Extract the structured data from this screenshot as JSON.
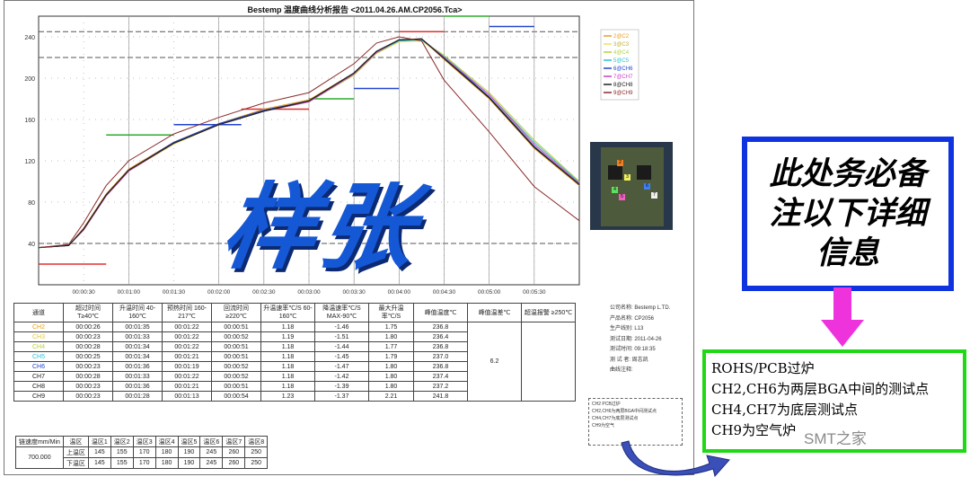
{
  "report_title": "Bestemp 温度曲线分析报告 <2011.04.26.AM.CP2056.Tca>",
  "stamp_text": "样张",
  "chart_data": {
    "type": "line",
    "xlabel": "",
    "ylabel": "",
    "x_range": [
      "00:00:00",
      "00:06:00"
    ],
    "ylim": [
      0,
      260
    ],
    "y_ticks": [
      "40",
      "80",
      "120",
      "160",
      "200",
      "240"
    ],
    "x_ticks": [
      "00:00:30",
      "00:01:00",
      "00:01:30",
      "00:02:00",
      "00:02:30",
      "00:03:00",
      "00:03:30",
      "00:04:00",
      "00:04:30",
      "00:05:00",
      "00:05:30"
    ],
    "x_seconds": [
      0,
      20,
      30,
      45,
      60,
      90,
      120,
      150,
      180,
      210,
      225,
      240,
      255,
      270,
      300,
      330,
      360
    ],
    "limit_lines": [
      40,
      220,
      245
    ],
    "zone_setpoints": [
      {
        "x0": 0,
        "x1": 45,
        "value": 20,
        "color": "#e03030"
      },
      {
        "x0": 45,
        "x1": 90,
        "value": 145,
        "color": "#2faa2f"
      },
      {
        "x0": 90,
        "x1": 135,
        "value": 155,
        "color": "#2244cc"
      },
      {
        "x0": 135,
        "x1": 180,
        "value": 170,
        "color": "#e03030"
      },
      {
        "x0": 180,
        "x1": 210,
        "value": 180,
        "color": "#2faa2f"
      },
      {
        "x0": 210,
        "x1": 240,
        "value": 190,
        "color": "#2244cc"
      },
      {
        "x0": 240,
        "x1": 270,
        "value": 245,
        "color": "#e03030"
      },
      {
        "x0": 270,
        "x1": 300,
        "value": 260,
        "color": "#2faa2f"
      },
      {
        "x0": 300,
        "x1": 330,
        "value": 250,
        "color": "#2244cc"
      }
    ],
    "legend_position": "top-right",
    "series": [
      {
        "name": "2@C2",
        "color": "#e8a020",
        "values": [
          36,
          38,
          55,
          88,
          112,
          138,
          156,
          170,
          179,
          205,
          226,
          237,
          238,
          218,
          180,
          132,
          96
        ]
      },
      {
        "name": "3@C3",
        "color": "#f0e060",
        "values": [
          36,
          38,
          53,
          86,
          110,
          136,
          155,
          168,
          177,
          203,
          224,
          235,
          236,
          220,
          182,
          136,
          98
        ]
      },
      {
        "name": "4@C4",
        "color": "#b8d040",
        "values": [
          36,
          38,
          53,
          86,
          110,
          137,
          155,
          168,
          177,
          203,
          224,
          236,
          237,
          222,
          186,
          140,
          100
        ]
      },
      {
        "name": "5@C5",
        "color": "#30c0d0",
        "values": [
          36,
          38,
          54,
          87,
          111,
          137,
          155,
          168,
          177,
          204,
          225,
          236,
          237,
          221,
          184,
          138,
          99
        ]
      },
      {
        "name": "6@CH6",
        "color": "#2244cc",
        "values": [
          36,
          38,
          54,
          87,
          111,
          138,
          156,
          169,
          178,
          205,
          226,
          237,
          238,
          220,
          182,
          134,
          97
        ]
      },
      {
        "name": "7@CH7",
        "color": "#d040c0",
        "values": [
          36,
          38,
          53,
          86,
          110,
          137,
          155,
          168,
          177,
          204,
          225,
          237,
          238,
          220,
          184,
          136,
          98
        ]
      },
      {
        "name": "8@CH8",
        "color": "#202020",
        "values": [
          36,
          38,
          54,
          87,
          111,
          137,
          155,
          168,
          178,
          205,
          226,
          237,
          238,
          219,
          181,
          133,
          97
        ]
      },
      {
        "name": "9@CH9",
        "color": "#8a2b2b",
        "values": [
          36,
          39,
          60,
          96,
          120,
          146,
          162,
          176,
          186,
          214,
          234,
          240,
          236,
          198,
          148,
          95,
          62
        ]
      }
    ]
  },
  "table": {
    "headers": [
      "通道",
      "超过时间 T≥40℃",
      "升温时间 40-160℃",
      "预热时间 160-217℃",
      "回流时间 ≥220℃",
      "升温速率℃/S 60-160℃",
      "降温速率℃/S MAX-90℃",
      "最大升温 率℃/S",
      "峰值温度℃",
      "峰值温差℃",
      "超温报警 ≥250℃"
    ],
    "rows": [
      {
        "ch": "CH2",
        "color": "#e8a020",
        "cells": [
          "00:00:26",
          "00:01:35",
          "00:01:22",
          "00:00:51",
          "1.18",
          "-1.46",
          "1.75",
          "236.8"
        ]
      },
      {
        "ch": "CH3",
        "color": "#e0c840",
        "cells": [
          "00:00:23",
          "00:01:33",
          "00:01:22",
          "00:00:52",
          "1.19",
          "-1.51",
          "1.80",
          "236.4"
        ]
      },
      {
        "ch": "CH4",
        "color": "#b8d040",
        "cells": [
          "00:00:28",
          "00:01:34",
          "00:01:22",
          "00:00:51",
          "1.18",
          "-1.44",
          "1.77",
          "236.8"
        ]
      },
      {
        "ch": "CH5",
        "color": "#30c0d0",
        "cells": [
          "00:00:25",
          "00:01:34",
          "00:01:21",
          "00:00:51",
          "1.18",
          "-1.45",
          "1.79",
          "237.0"
        ]
      },
      {
        "ch": "CH6",
        "color": "#2244cc",
        "cells": [
          "00:00:23",
          "00:01:36",
          "00:01:19",
          "00:00:52",
          "1.18",
          "-1.47",
          "1.80",
          "236.8"
        ]
      },
      {
        "ch": "CH7",
        "color": "#222222",
        "cells": [
          "00:00:28",
          "00:01:33",
          "00:01:22",
          "00:00:52",
          "1.18",
          "-1.42",
          "1.80",
          "237.4"
        ]
      },
      {
        "ch": "CH8",
        "color": "#222222",
        "cells": [
          "00:00:23",
          "00:01:36",
          "00:01:21",
          "00:00:51",
          "1.18",
          "-1.39",
          "1.80",
          "237.2"
        ]
      },
      {
        "ch": "CH9",
        "color": "#222222",
        "cells": [
          "00:00:23",
          "00:01:28",
          "00:01:13",
          "00:00:54",
          "1.23",
          "-1.37",
          "2.21",
          "241.8"
        ]
      }
    ],
    "peak_delta": "6.2"
  },
  "info": [
    "公司名称: Bestemp L.TD.",
    "产品名称: CP2056",
    "生产线别: L13",
    "测试日期: 2011-04-26",
    "测试时间: 09:18:35",
    "测 试 者: 周志凯",
    "曲线注释:"
  ],
  "notes": [
    "CH2 PCB过炉",
    "CH2,CH6为两层BGA中间测试点",
    "CH4,CH7为底层测试点",
    "CH9为空气"
  ],
  "speed_table": {
    "label": "链速度mm/Min",
    "value": "700.000",
    "zone_header": "温区",
    "zones": [
      "温区1",
      "温区2",
      "温区3",
      "温区4",
      "温区5",
      "温区6",
      "温区7",
      "温区8"
    ],
    "upper_label": "上温区",
    "lower_label": "下温区",
    "upper": [
      "145",
      "155",
      "170",
      "180",
      "190",
      "245",
      "260",
      "250"
    ],
    "lower": [
      "145",
      "155",
      "170",
      "180",
      "190",
      "245",
      "260",
      "250"
    ]
  },
  "callout_blue": "此处务必备注以下详细信息",
  "callout_green": [
    "ROHS/PCB过炉",
    "CH2,CH6为两层BGA中间的测试点",
    "CH4,CH7为底层测试点",
    "CH9为空气炉"
  ],
  "watermark": "SMT之家",
  "photo_markers": [
    "2",
    "3",
    "4",
    "5",
    "6",
    "7"
  ]
}
